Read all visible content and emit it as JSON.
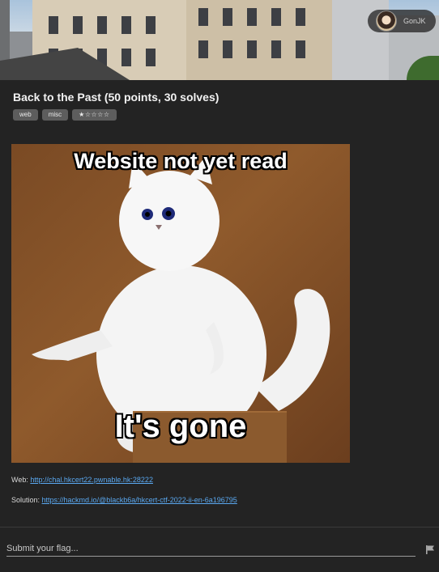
{
  "header": {
    "user": {
      "name": "GonJK",
      "avatar_icon": "avatar"
    }
  },
  "challenge": {
    "title": "Back to the Past (50 points, 30 solves)",
    "tags": [
      "web",
      "misc"
    ],
    "rating": "★☆☆☆☆"
  },
  "meme": {
    "top_text": "Website not yet read",
    "bottom_text": "It's gone"
  },
  "links": {
    "web_label": "Web: ",
    "web_url": "http://chal.hkcert22.pwnable.hk:28222",
    "solution_label": "Solution: ",
    "solution_url": "https://hackmd.io/@blackb6a/hkcert-ctf-2022-ii-en-6a196795"
  },
  "flag": {
    "placeholder": "Submit your flag...",
    "value": "",
    "submit_icon": "flag-icon"
  },
  "colors": {
    "background": "#232323",
    "link": "#5aa8f0",
    "tag_bg": "#5d5d5d"
  }
}
